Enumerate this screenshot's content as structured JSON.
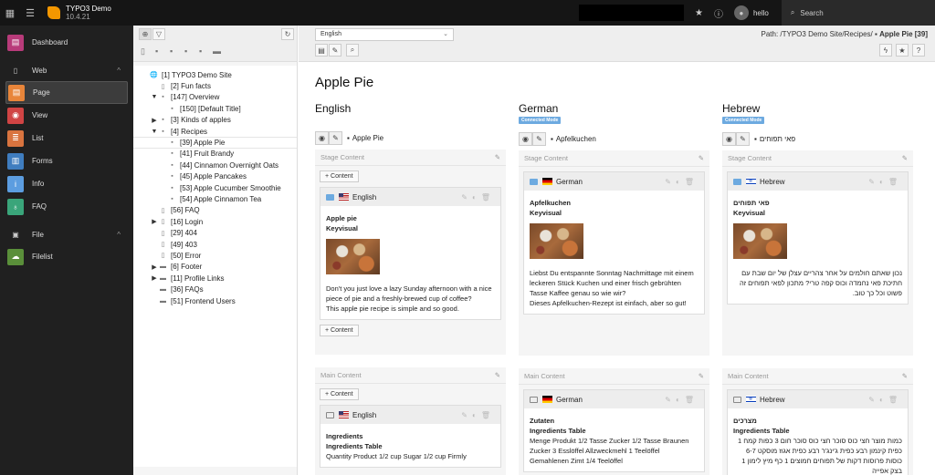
{
  "topbar": {
    "app_name": "TYPO3 Demo",
    "version": "10.4.21",
    "username": "hello",
    "search_label": "Search"
  },
  "module_menu": {
    "dashboard": "Dashboard",
    "groups": [
      {
        "label": "Web",
        "items": [
          {
            "label": "Page",
            "color": "#e8853a",
            "active": true
          },
          {
            "label": "View",
            "color": "#d04444"
          },
          {
            "label": "List",
            "color": "#d9743f"
          },
          {
            "label": "Forms",
            "color": "#3f7dbf"
          },
          {
            "label": "Info",
            "color": "#5c9de0"
          },
          {
            "label": "FAQ",
            "color": "#3aa57a"
          }
        ]
      },
      {
        "label": "File",
        "items": [
          {
            "label": "Filelist",
            "color": "#5a8f3a"
          }
        ]
      }
    ]
  },
  "page_tree": {
    "nodes": [
      "[1] TYPO3 Demo Site",
      "[2] Fun facts",
      "[147] Overview",
      "[150] [Default Title]",
      "[3] Kinds of apples",
      "[4] Recipes",
      "[39] Apple Pie",
      "[41] Fruit Brandy",
      "[44] Cinnamon Overnight Oats",
      "[45] Apple Pancakes",
      "[53] Apple Cucumber Smoothie",
      "[54] Apple Cinnamon Tea",
      "[56] FAQ",
      "[16] Login",
      "[29] 404",
      "[49] 403",
      "[50] Error",
      "[6] Footer",
      "[11] Profile Links",
      "[36] FAQs",
      "[51] Frontend Users"
    ],
    "selected": "[39] Apple Pie"
  },
  "doc_header": {
    "language_select": "English",
    "path_label": "Path: /TYPO3 Demo Site/Recipes/",
    "path_page": "Apple Pie [39]"
  },
  "page": {
    "title": "Apple Pie",
    "stage_label": "Stage Content",
    "main_label": "Main Content",
    "add_content": "+ Content",
    "columns": [
      {
        "language": "English",
        "badge": "",
        "page_title": "Apple Pie",
        "stage": {
          "header": "English",
          "title": "Apple pie",
          "subtitle": "Keyvisual",
          "text": "Don't you just love a lazy Sunday afternoon with a nice piece of pie and a freshly-brewed cup of coffee?\nThis apple pie recipe is simple and so good."
        },
        "main": {
          "header": "English",
          "title": "Ingredients",
          "subtitle": "Ingredients Table",
          "text": "Quantity Product 1/2 cup Sugar 1/2 cup Firmly"
        }
      },
      {
        "language": "German",
        "badge": "Connected Mode",
        "page_title": "Apfelkuchen",
        "stage": {
          "header": "German",
          "title": "Apfelkuchen",
          "subtitle": "Keyvisual",
          "text": "Liebst Du entspannte Sonntag Nachmittage mit einem leckeren Stück Kuchen und einer frisch gebrühten Tasse Kaffee genau so wie wir?\nDieses Apfelkuchen-Rezept ist einfach, aber so gut!"
        },
        "main": {
          "header": "German",
          "title": "Zutaten",
          "subtitle": "Ingredients Table",
          "text": "Menge Produkt 1/2 Tasse Zucker 1/2 Tasse Braunen Zucker 3 Esslöffel Allzweckmehl 1 Teelöffel Gemahlenen Zimt 1/4 Teelöffel"
        }
      },
      {
        "language": "Hebrew",
        "badge": "Connected Mode",
        "page_title": "פאי תפוחים",
        "stage": {
          "header": "Hebrew",
          "title": "פאי תפוחים",
          "subtitle": "Keyvisual",
          "text": "נכון שאתם חולמים על אחר צהריים עצלן של יום שבת עם חתיכת פאי נחמדה וכוס קפה טרי? מתכון לפאי תפוחים זה פשוט וכל כך טוב."
        },
        "main": {
          "header": "Hebrew",
          "title": "מצרכים",
          "subtitle": "Ingredients Table",
          "text": "כמות מוצר חצי כוס סוכר חצי כוס סוכר חום 3 כפות קמח 1 כפית קינמון רבע כפית ג'ינג'ר רבע כפית אגוז מוסקט 6-7 כוסות פרוסות דקות של תפוחים חמוצים 1 כף מיץ לימון 1 בצק אפייה"
        }
      }
    ]
  }
}
